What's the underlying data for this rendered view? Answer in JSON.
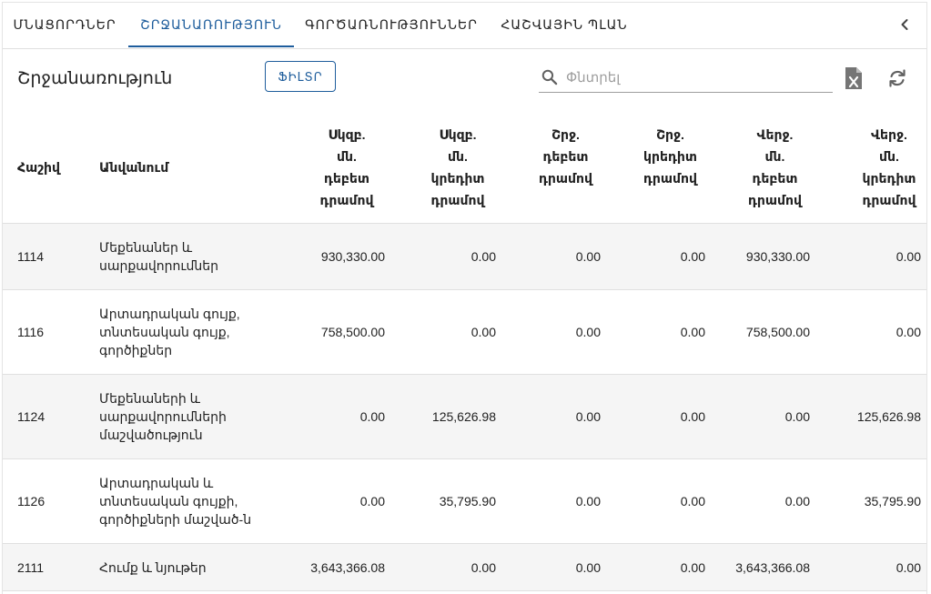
{
  "tabs": [
    {
      "label": "ՄՆԱՑՈՐԴՆԵՐ",
      "active": false
    },
    {
      "label": "ՇՐՋԱՆԱՌՈՒԹՅՈՒՆ",
      "active": true
    },
    {
      "label": "ԳՈՐԾԱՌՆՈՒԹՅՈՒՆՆԵՐ",
      "active": false
    },
    {
      "label": "ՀԱՇՎԱՅԻՆ ՊԼԱՆ",
      "active": false
    }
  ],
  "collapse_icon": "chevron-left-icon",
  "toolbar": {
    "title": "Շրջանառություն",
    "filter_label": "ՖԻԼՏՐ",
    "search_placeholder": "Փնտրել",
    "search_value": "",
    "excel_icon": "excel-export-icon",
    "refresh_icon": "refresh-icon"
  },
  "accent_color": "#1e5d9c",
  "table": {
    "columns": [
      {
        "lines": [
          "Հաշիվ"
        ]
      },
      {
        "lines": [
          "Անվանում"
        ]
      },
      {
        "lines": [
          "Սկզբ.",
          "մն.",
          "դեբետ",
          "դրամով"
        ]
      },
      {
        "lines": [
          "Սկզբ.",
          "մն.",
          "կրեդիտ",
          "դրամով"
        ]
      },
      {
        "lines": [
          "Շրջ.",
          "դեբետ",
          "դրամով"
        ]
      },
      {
        "lines": [
          "Շրջ.",
          "կրեդիտ",
          "դրամով"
        ]
      },
      {
        "lines": [
          "Վերջ.",
          "մն.",
          "դեբետ",
          "դրամով"
        ]
      },
      {
        "lines": [
          "Վերջ.",
          "մն.",
          "կրեդիտ",
          "դրամով"
        ]
      }
    ],
    "rows": [
      {
        "account": "1114",
        "name_lines": [
          "Մեքենաներ և",
          "սարքավորումներ"
        ],
        "values": [
          "930,330.00",
          "0.00",
          "0.00",
          "0.00",
          "930,330.00",
          "0.00"
        ]
      },
      {
        "account": "1116",
        "name_lines": [
          "Արտադրական գույք,",
          "տնտեսական գույք,",
          "գործիքներ"
        ],
        "values": [
          "758,500.00",
          "0.00",
          "0.00",
          "0.00",
          "758,500.00",
          "0.00"
        ]
      },
      {
        "account": "1124",
        "name_lines": [
          "Մեքենաների և",
          "սարքավորումների",
          "մաշվածություն"
        ],
        "values": [
          "0.00",
          "125,626.98",
          "0.00",
          "0.00",
          "0.00",
          "125,626.98"
        ]
      },
      {
        "account": "1126",
        "name_lines": [
          "Արտադրական և",
          "տնտեսական գույքի,",
          "գործիքների մաշված-ն"
        ],
        "values": [
          "0.00",
          "35,795.90",
          "0.00",
          "0.00",
          "0.00",
          "35,795.90"
        ]
      },
      {
        "account": "2111",
        "name_lines": [
          "Հումք և նյութեր"
        ],
        "values": [
          "3,643,366.08",
          "0.00",
          "0.00",
          "0.00",
          "3,643,366.08",
          "0.00"
        ]
      }
    ]
  }
}
